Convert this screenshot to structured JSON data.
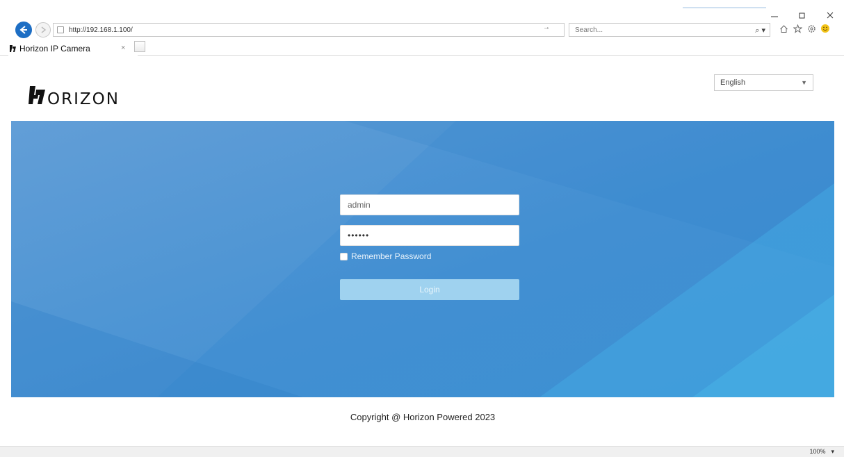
{
  "browser": {
    "address": "http://192.168.1.100/",
    "go_symbol": "→",
    "search_placeholder": "Search...",
    "search_symbol": "⌕ ▾",
    "tab_title": "Horizon IP Camera",
    "tab_close": "×",
    "zoom_level": "100%",
    "zoom_arrow": "▾",
    "accent_color": "#1d6ec4"
  },
  "header": {
    "brand_text": "ORIZON",
    "language": "English",
    "language_arrow": "▼"
  },
  "login": {
    "username_value": "admin",
    "password_value": "••••••",
    "remember_label": "Remember Password",
    "remember_checked": false,
    "login_label": "Login",
    "banner_color": "#3f8dd0",
    "button_color": "#9fd2ef"
  },
  "footer": {
    "copyright": "Copyright @ Horizon Powered 2023"
  }
}
